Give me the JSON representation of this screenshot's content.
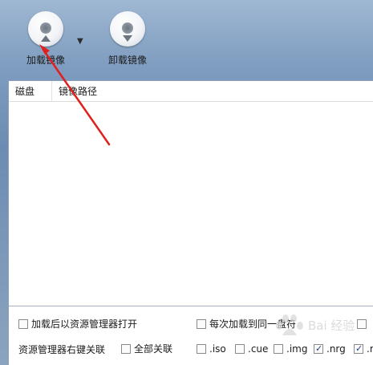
{
  "toolbar": {
    "load_label": "加载镜像",
    "unload_label": "卸载镜像",
    "dropdown_glyph": "▼"
  },
  "list": {
    "columns": [
      "磁盘",
      "镜像路径"
    ]
  },
  "options": {
    "open_explorer": "加载后以资源管理器打开",
    "load_same_drive": "每次加载到同一盘符",
    "context_menu_label": "资源管理器右键关联",
    "all_assoc": "全部关联",
    "ext_iso": ".iso",
    "ext_cue": ".cue",
    "ext_img": ".img",
    "ext_nrg": ".nrg",
    "ext_more": ".r"
  },
  "watermark": {
    "text": "Bai 经验"
  }
}
